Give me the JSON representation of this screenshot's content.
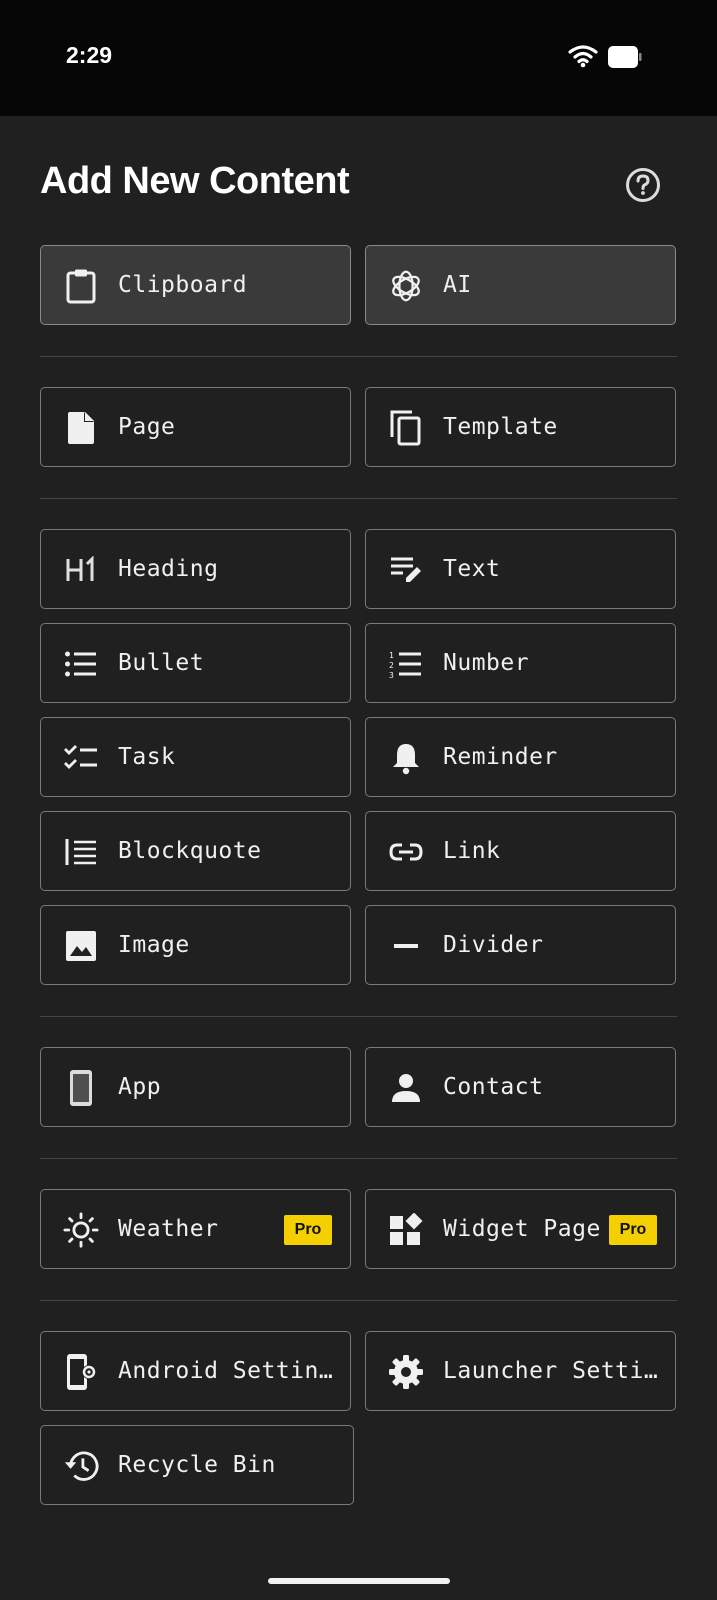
{
  "status_bar": {
    "time": "2:29"
  },
  "header": {
    "title": "Add New Content"
  },
  "groups": {
    "quick": [
      {
        "label": "Clipboard",
        "icon": "clipboard-icon"
      },
      {
        "label": "AI",
        "icon": "openai-icon"
      }
    ],
    "pages": [
      {
        "label": "Page",
        "icon": "page-icon"
      },
      {
        "label": "Template",
        "icon": "copy-icon"
      }
    ],
    "blocks": [
      {
        "label": "Heading",
        "icon": "heading-h1-icon"
      },
      {
        "label": "Text",
        "icon": "text-edit-icon"
      },
      {
        "label": "Bullet",
        "icon": "bullet-list-icon"
      },
      {
        "label": "Number",
        "icon": "numbered-list-icon"
      },
      {
        "label": "Task",
        "icon": "checklist-icon"
      },
      {
        "label": "Reminder",
        "icon": "bell-icon"
      },
      {
        "label": "Blockquote",
        "icon": "blockquote-icon"
      },
      {
        "label": "Link",
        "icon": "link-icon"
      },
      {
        "label": "Image",
        "icon": "image-icon"
      },
      {
        "label": "Divider",
        "icon": "minus-icon"
      }
    ],
    "shortcuts": [
      {
        "label": "App",
        "icon": "phone-icon"
      },
      {
        "label": "Contact",
        "icon": "person-icon"
      }
    ],
    "pro": [
      {
        "label": "Weather",
        "icon": "sun-icon",
        "badge": "Pro"
      },
      {
        "label": "Widget Page",
        "icon": "widgets-icon",
        "badge": "Pro"
      }
    ],
    "settings": [
      {
        "label": "Android Settin…",
        "icon": "phone-settings-icon"
      },
      {
        "label": "Launcher Setti…",
        "icon": "gear-icon"
      },
      {
        "label": "Recycle Bin",
        "icon": "history-icon"
      }
    ]
  },
  "colors": {
    "background": "#202020",
    "tile_border": "#7a7a7a",
    "tile_filled": "#3a3a3a",
    "pro_badge": "#f5d000"
  }
}
